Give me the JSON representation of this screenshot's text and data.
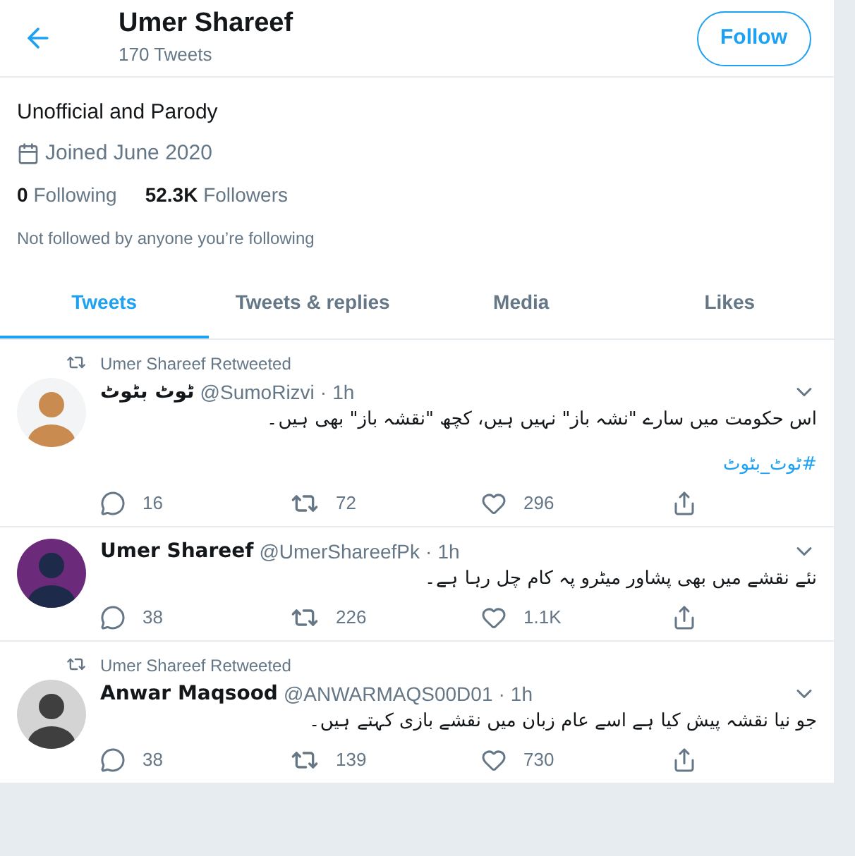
{
  "header": {
    "name": "Umer Shareef",
    "tweet_count": "170 Tweets",
    "follow_button": "Follow"
  },
  "profile": {
    "bio": "Unofficial and Parody",
    "joined": "Joined June 2020",
    "following_count": "0",
    "following_label": "Following",
    "followers_count": "52.3K",
    "followers_label": "Followers",
    "followed_by": "Not followed by anyone you’re following"
  },
  "tabs": [
    {
      "label": "Tweets",
      "selected": true
    },
    {
      "label": "Tweets & replies",
      "selected": false
    },
    {
      "label": "Media",
      "selected": false
    },
    {
      "label": "Likes",
      "selected": false
    }
  ],
  "tweets": [
    {
      "retweeted_by": "Umer Shareef Retweeted",
      "name": "ٹوٹ بٹوٹ",
      "handle": "@SumoRizvi",
      "separator": "·",
      "time": "1h",
      "text": "اس حکومت میں سارے \"نشہ باز\" نہیں ہیں، کچھ \"نقشہ باز\" بھی ہیں۔",
      "hashtag": "#ٹوٹ_بٹوٹ",
      "replies": "16",
      "retweets": "72",
      "likes": "296"
    },
    {
      "name": "Umer Shareef",
      "handle": "@UmerShareefPk",
      "separator": "·",
      "time": "1h",
      "text": "نئے نقشے میں بھی پشاور میٹرو پہ کام چل رہا ہے۔",
      "replies": "38",
      "retweets": "226",
      "likes": "1.1K"
    },
    {
      "retweeted_by": "Umer Shareef Retweeted",
      "name": "Anwar Maqsood",
      "handle": "@ANWARMAQS00D01",
      "separator": "·",
      "time": "1h",
      "text": "جو نیا نقشہ پیش کیا ہے اسے عام زبان میں نقشے بازی کہتے ہیں۔",
      "replies": "38",
      "retweets": "139",
      "likes": "730"
    }
  ]
}
